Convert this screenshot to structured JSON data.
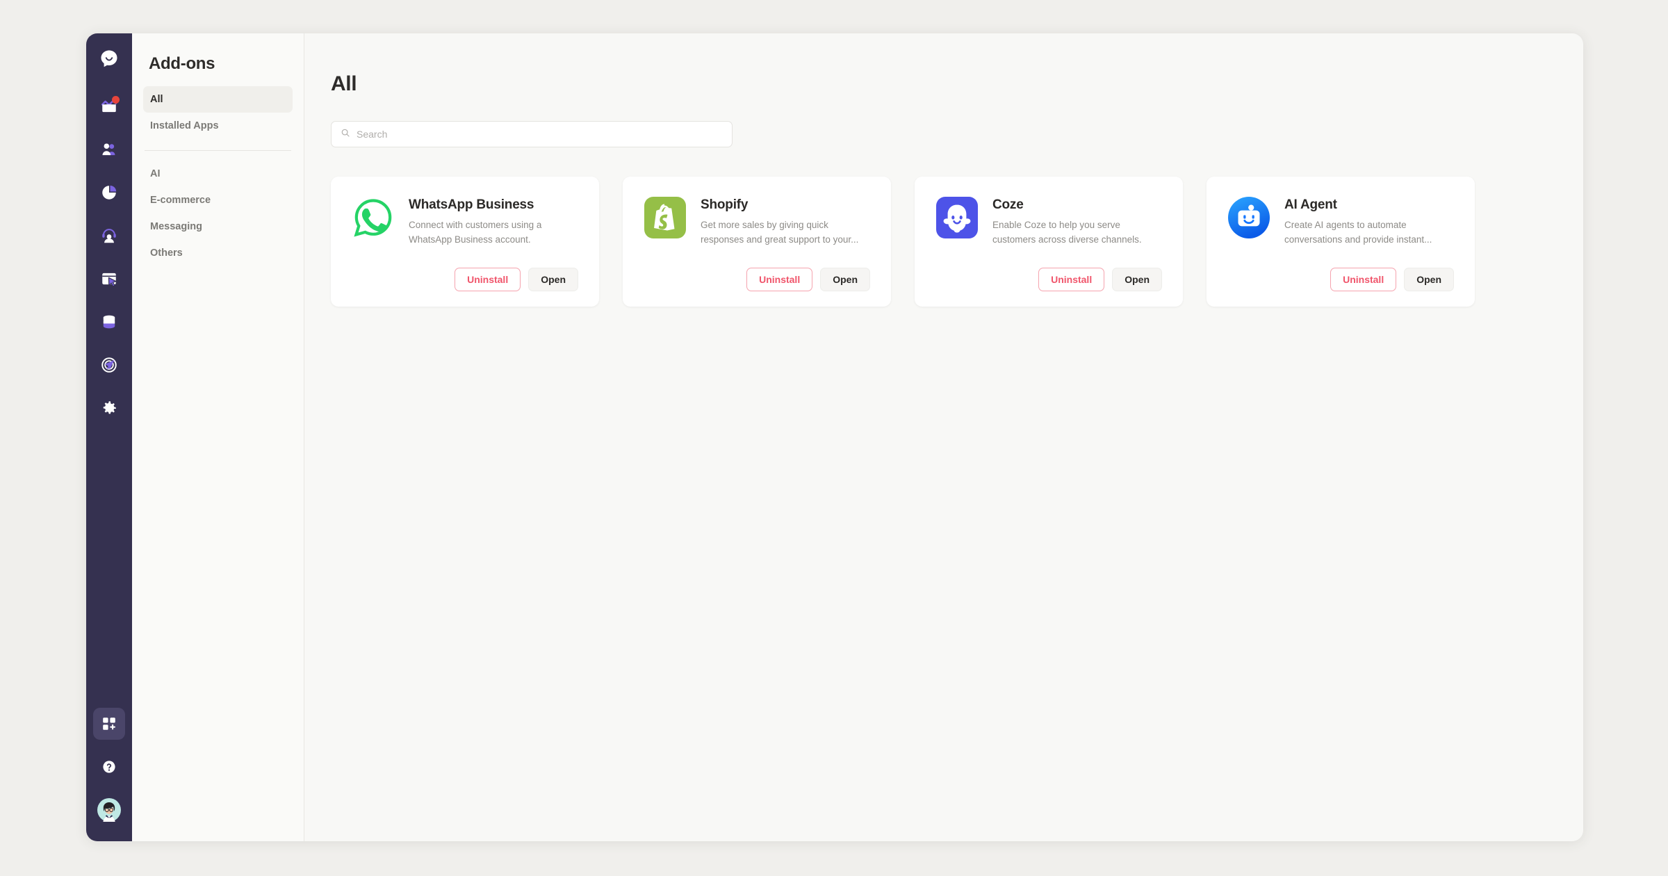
{
  "rail": {
    "items": [
      {
        "name": "logo",
        "icon": "chat-bubble-logo-icon",
        "active": false,
        "badge": false
      },
      {
        "name": "inbox",
        "icon": "inbox-icon",
        "active": false,
        "badge": true
      },
      {
        "name": "contacts",
        "icon": "contacts-icon",
        "active": false,
        "badge": false
      },
      {
        "name": "analytics",
        "icon": "pie-chart-icon",
        "active": false,
        "badge": false
      },
      {
        "name": "agents",
        "icon": "headset-agent-icon",
        "active": false,
        "badge": false
      },
      {
        "name": "widgets",
        "icon": "window-cursor-icon",
        "active": false,
        "badge": false
      },
      {
        "name": "data",
        "icon": "database-icon",
        "active": false,
        "badge": false
      },
      {
        "name": "campaigns",
        "icon": "send-target-icon",
        "active": false,
        "badge": false
      },
      {
        "name": "settings",
        "icon": "gear-icon",
        "active": false,
        "badge": false
      }
    ],
    "bottom": [
      {
        "name": "add-ons",
        "icon": "grid-plus-icon",
        "active": true,
        "badge": false
      },
      {
        "name": "help",
        "icon": "help-circle-icon",
        "active": false,
        "badge": false
      },
      {
        "name": "profile",
        "icon": "avatar-icon",
        "active": false,
        "badge": false
      }
    ]
  },
  "subnav": {
    "title": "Add-ons",
    "primary": [
      {
        "label": "All",
        "active": true
      },
      {
        "label": "Installed Apps",
        "active": false
      }
    ],
    "categories": [
      {
        "label": "AI",
        "active": false
      },
      {
        "label": "E-commerce",
        "active": false
      },
      {
        "label": "Messaging",
        "active": false
      },
      {
        "label": "Others",
        "active": false
      }
    ]
  },
  "main": {
    "title": "All",
    "search": {
      "value": "",
      "placeholder": "Search"
    },
    "buttons": {
      "uninstall": "Uninstall",
      "open": "Open"
    },
    "cards": [
      {
        "name": "WhatsApp Business",
        "description": "Connect with customers using a WhatsApp Business account.",
        "icon": "whatsapp-icon",
        "icon_color": "#25D366"
      },
      {
        "name": "Shopify",
        "description": "Get more sales by giving quick responses and great support to your...",
        "icon": "shopify-icon",
        "icon_color": "#95BF47"
      },
      {
        "name": "Coze",
        "description": "Enable Coze to help you serve customers across diverse channels.",
        "icon": "coze-icon",
        "icon_color": "#4D53E8"
      },
      {
        "name": "AI Agent",
        "description": "Create AI agents to automate conversations and provide instant...",
        "icon": "ai-agent-icon",
        "icon_color": "#1677FF"
      }
    ]
  },
  "colors": {
    "rail_background": "#353150",
    "page_background": "#f0efec",
    "panel_background": "#f8f8f6",
    "accent_purple": "#7c64e0",
    "danger": "#f0556b",
    "badge_red": "#e8453c"
  }
}
